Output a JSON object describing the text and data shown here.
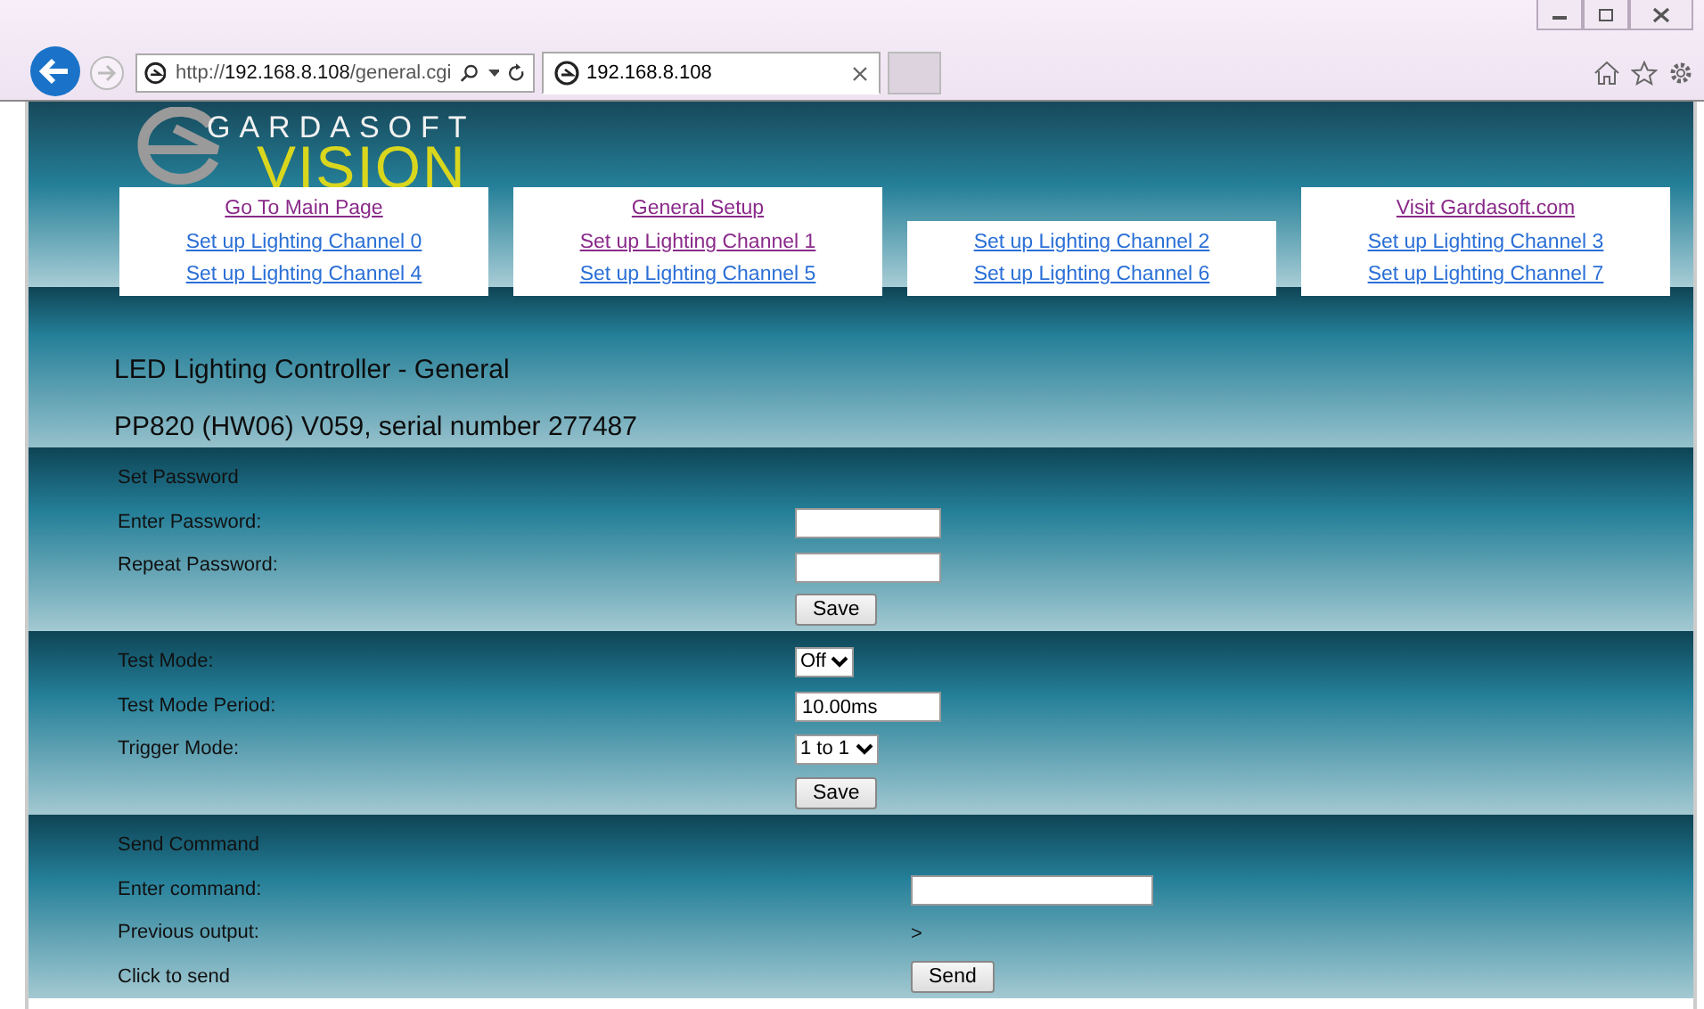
{
  "browser": {
    "address": "http://**192.168.8.108**/general.cgi",
    "tab": {
      "title": "192.168.8.108",
      "selected": true
    }
  },
  "logo": {
    "top": "GARDASOFT",
    "bottom": "VISION"
  },
  "nav": [
    {
      "links": [
        {
          "label": "Go To Main Page",
          "visited": true
        },
        {
          "label": "Set up Lighting Channel 0",
          "visited": false
        },
        {
          "label": "Set up Lighting Channel 4",
          "visited": false
        }
      ]
    },
    {
      "links": [
        {
          "label": "General Setup",
          "visited": true
        },
        {
          "label": "Set up Lighting Channel 1",
          "visited": true
        },
        {
          "label": "Set up Lighting Channel 5",
          "visited": false
        }
      ]
    },
    {
      "links": [
        {
          "label": "Set up Lighting Channel 2",
          "visited": false
        },
        {
          "label": "Set up Lighting Channel 6",
          "visited": false
        }
      ]
    },
    {
      "links": [
        {
          "label": "Visit Gardasoft.com",
          "visited": true
        },
        {
          "label": "Set up Lighting Channel 3",
          "visited": false
        },
        {
          "label": "Set up Lighting Channel 7",
          "visited": false
        }
      ]
    }
  ],
  "heading": "LED Lighting Controller - General",
  "device": "PP820 (HW06) V059, serial number 277487",
  "sections": [
    {
      "rows": [
        {
          "kind": "title",
          "label": "Set Password"
        },
        {
          "kind": "input",
          "label": "Enter Password:"
        },
        {
          "kind": "input",
          "label": "Repeat Password:"
        },
        {
          "kind": "button",
          "button": "Save"
        }
      ]
    },
    {
      "rows": [
        {
          "kind": "select",
          "label": "Test Mode:",
          "value": "Off"
        },
        {
          "kind": "input",
          "label": "Test Mode Period:",
          "value": "10.00ms"
        },
        {
          "kind": "select",
          "label": "Trigger Mode:",
          "value": "1 to 1"
        },
        {
          "kind": "button",
          "button": "Save"
        }
      ]
    },
    {
      "rows": [
        {
          "kind": "title",
          "label": "Send Command"
        },
        {
          "kind": "input",
          "label": "Enter command:"
        },
        {
          "kind": "output",
          "label": "Previous output:",
          "value": ">"
        },
        {
          "kind": "button",
          "label": "Click to send",
          "button": "Send"
        }
      ]
    }
  ]
}
